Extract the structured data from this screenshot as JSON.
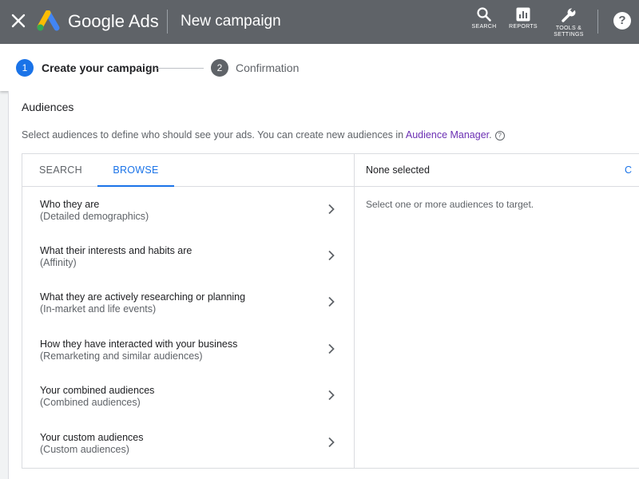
{
  "header": {
    "brand": "Google Ads",
    "page_title": "New campaign",
    "tools": [
      {
        "label": "SEARCH",
        "icon": "search-icon"
      },
      {
        "label": "REPORTS",
        "icon": "reports-icon"
      },
      {
        "label": "TOOLS &\nSETTINGS",
        "icon": "wrench-icon"
      }
    ],
    "help": "?"
  },
  "stepper": {
    "steps": [
      {
        "number": "1",
        "label": "Create your campaign",
        "state": "active"
      },
      {
        "number": "2",
        "label": "Confirmation",
        "state": "inactive"
      }
    ]
  },
  "audiences": {
    "title": "Audiences",
    "description": "Select audiences to define who should see your ads. You can create new audiences in ",
    "link": "Audience Manager",
    "description_end": ".",
    "tabs": [
      {
        "label": "SEARCH",
        "selected": false
      },
      {
        "label": "BROWSE",
        "selected": true
      }
    ],
    "categories": [
      {
        "title": "Who they are",
        "subtitle": "(Detailed demographics)"
      },
      {
        "title": "What their interests and habits are",
        "subtitle": "(Affinity)"
      },
      {
        "title": "What they are actively researching or planning",
        "subtitle": "(In-market and life events)"
      },
      {
        "title": "How they have interacted with your business",
        "subtitle": "(Remarketing and similar audiences)"
      },
      {
        "title": "Your combined audiences",
        "subtitle": "(Combined audiences)"
      },
      {
        "title": "Your custom audiences",
        "subtitle": "(Custom audiences)"
      }
    ],
    "selection": {
      "header": "None selected",
      "action_partial": "C",
      "hint": "Select one or more audiences to target."
    }
  },
  "colors": {
    "topbar": "#5f6368",
    "accent": "#1a73e8",
    "link": "#6b2fb3"
  }
}
